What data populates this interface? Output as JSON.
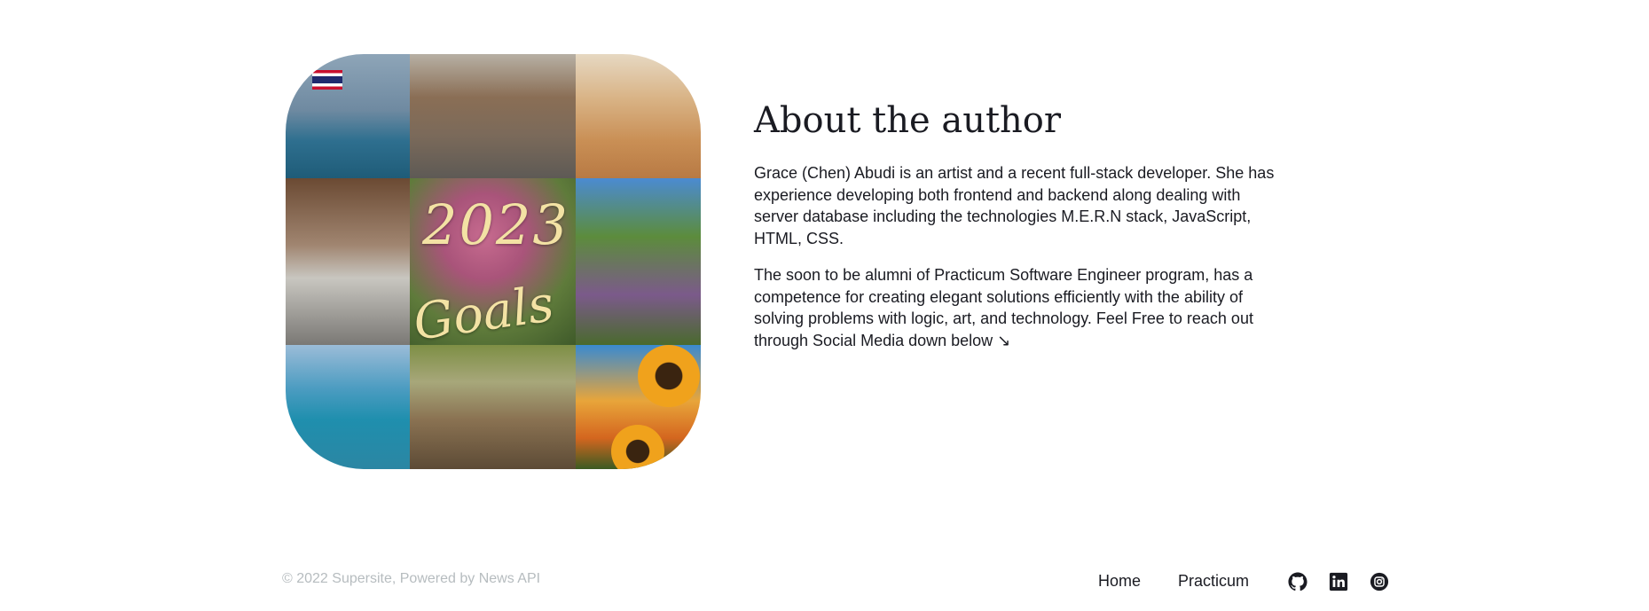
{
  "about": {
    "title": "About the author",
    "paragraph_1": "Grace (Chen) Abudi is an artist and a recent full-stack developer. She has experience developing both frontend and backend along dealing with server database including the technologies M.E.R.N stack, JavaScript, HTML, CSS.",
    "paragraph_2": "The soon to be alumni of Practicum Software Engineer program, has a competence for creating elegant solutions efficiently with the ability of solving problems with logic, art, and technology. Feel Free to reach out through Social Media down below ↘",
    "collage": {
      "year_text": "2023",
      "goals_text": "Goals"
    }
  },
  "footer": {
    "copyright": "© 2022 Supersite, Powered by News API",
    "nav": {
      "home": "Home",
      "practicum": "Practicum"
    },
    "social_icons": [
      "github-icon",
      "linkedin-icon",
      "instagram-icon"
    ]
  },
  "colors": {
    "text": "#1a1b22",
    "muted": "#b6bcbf",
    "background": "#ffffff"
  }
}
